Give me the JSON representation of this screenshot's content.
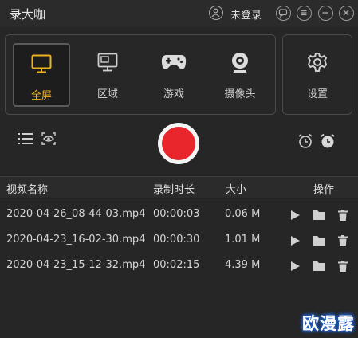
{
  "app": {
    "title": "录大咖"
  },
  "header": {
    "login_label": "未登录"
  },
  "modes": [
    {
      "label": "全屏",
      "icon": "monitor-icon",
      "active": true
    },
    {
      "label": "区域",
      "icon": "region-icon",
      "active": false
    },
    {
      "label": "游戏",
      "icon": "gamepad-icon",
      "active": false
    },
    {
      "label": "摄像头",
      "icon": "webcam-icon",
      "active": false
    }
  ],
  "settings": {
    "label": "设置",
    "icon": "gear-icon"
  },
  "colors": {
    "accent": "#f0b320",
    "record": "#e8262b",
    "background": "#262626"
  },
  "table": {
    "headers": {
      "name": "视频名称",
      "duration": "录制时长",
      "size": "大小",
      "actions": "操作"
    },
    "rows": [
      {
        "name": "2020-04-26_08-44-03.mp4",
        "duration": "00:00:03",
        "size": "0.06 M"
      },
      {
        "name": "2020-04-23_16-02-30.mp4",
        "duration": "00:00:30",
        "size": "1.01 M"
      },
      {
        "name": "2020-04-23_15-12-32.mp4",
        "duration": "00:02:15",
        "size": "4.39 M"
      }
    ]
  },
  "watermark": "欧漫露"
}
